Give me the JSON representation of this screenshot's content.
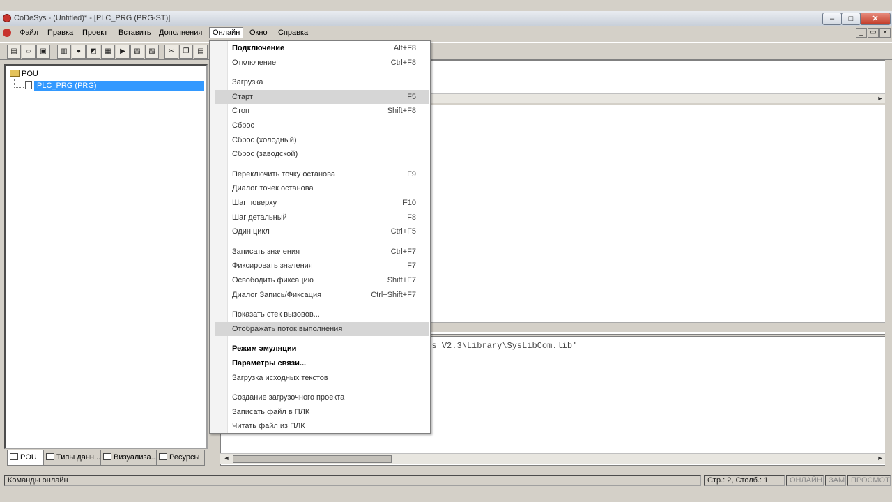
{
  "window": {
    "title": "CoDeSys - (Untitled)* - [PLC_PRG (PRG-ST)]",
    "minimize": "‒",
    "maximize": "□",
    "close": "✕"
  },
  "menubar": {
    "items": [
      "Файл",
      "Правка",
      "Проект",
      "Вставить",
      "Дополнения",
      "Онлайн",
      "Окно",
      "Справка"
    ],
    "active": "Онлайн",
    "mdi_minimize": "_",
    "mdi_restore": "▭",
    "mdi_close": "×"
  },
  "toolbar": {
    "icons": [
      "new-file-icon",
      "open-file-icon",
      "save-icon",
      "build-icon",
      "stop-icon",
      "login-icon",
      "logout-icon",
      "run-icon",
      "step-icon",
      "reset-icon",
      "cut-icon",
      "copy-icon",
      "paste-icon"
    ]
  },
  "left_panel": {
    "root": "POU",
    "item": "PLC_PRG (PRG)",
    "tabs": [
      "POU",
      "Типы данн...",
      "Визуализа...",
      "Ресурсы"
    ]
  },
  "message_pane": {
    "line": "'C:\\Program Files (x86)\\3S Software\\CoDeSys V2.3\\Library\\SysLibCom.lib'"
  },
  "online_menu": {
    "groups": [
      [
        {
          "label": "Подключение",
          "shortcut": "Alt+F8",
          "bold": true
        },
        {
          "label": "Отключение",
          "shortcut": "Ctrl+F8"
        }
      ],
      [
        {
          "label": "Загрузка",
          "shortcut": ""
        },
        {
          "label": "Старт",
          "shortcut": "F5",
          "highlighted": true
        },
        {
          "label": "Стоп",
          "shortcut": "Shift+F8"
        },
        {
          "label": "Сброс",
          "shortcut": ""
        },
        {
          "label": "Сброс (холодный)",
          "shortcut": ""
        },
        {
          "label": "Сброс (заводской)",
          "shortcut": ""
        }
      ],
      [
        {
          "label": "Переключить точку останова",
          "shortcut": "F9"
        },
        {
          "label": "Диалог точек останова",
          "shortcut": ""
        },
        {
          "label": "Шаг поверху",
          "shortcut": "F10"
        },
        {
          "label": "Шаг детальный",
          "shortcut": "F8"
        },
        {
          "label": "Один цикл",
          "shortcut": "Ctrl+F5"
        }
      ],
      [
        {
          "label": "Записать значения",
          "shortcut": "Ctrl+F7"
        },
        {
          "label": "Фиксировать значения",
          "shortcut": "F7"
        },
        {
          "label": "Освободить фиксацию",
          "shortcut": "Shift+F7"
        },
        {
          "label": "Диалог Запись/Фиксация",
          "shortcut": "Ctrl+Shift+F7"
        }
      ],
      [
        {
          "label": "Показать стек вызовов...",
          "shortcut": ""
        },
        {
          "label": "Отображать поток выполнения",
          "shortcut": "",
          "highlighted": true
        }
      ],
      [
        {
          "label": "Режим эмуляции",
          "shortcut": "",
          "bold": true
        },
        {
          "label": "Параметры связи...",
          "shortcut": "",
          "bold": true
        },
        {
          "label": "Загрузка исходных текстов",
          "shortcut": ""
        }
      ],
      [
        {
          "label": "Создание загрузочного проекта",
          "shortcut": ""
        },
        {
          "label": "Записать файл в ПЛК",
          "shortcut": ""
        },
        {
          "label": "Читать файл из ПЛК",
          "shortcut": ""
        }
      ]
    ]
  },
  "statusbar": {
    "message": "Команды онлайн",
    "position": "Стр.: 2, Столб.: 1",
    "online": "ОНЛАЙН",
    "zam": "ЗАМ",
    "view": "ПРОСМОТР"
  }
}
